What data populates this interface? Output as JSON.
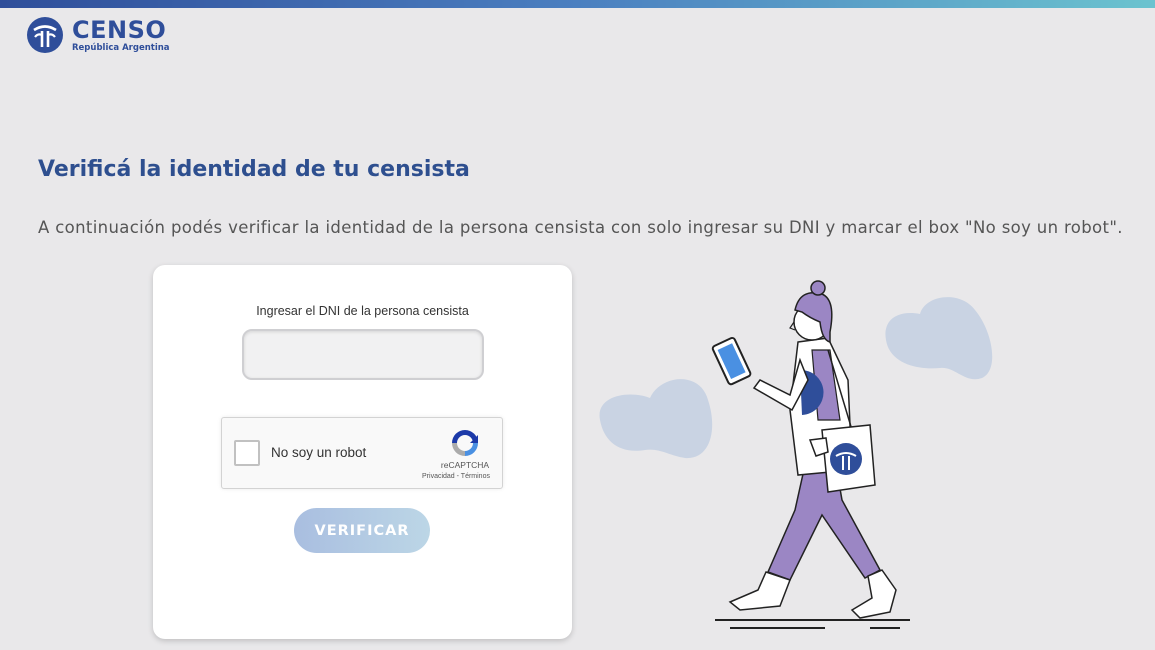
{
  "brand": {
    "name": "CENSO",
    "subtitle": "República Argentina",
    "logo_icon": "censo-emblem-icon",
    "color": "#2f4e9a"
  },
  "page": {
    "title": "Verificá la identidad de tu censista",
    "description": "A continuación podés verificar la identidad de la persona censista con solo ingresar su DNI y marcar el box \"No soy un robot\"."
  },
  "form": {
    "dni_label": "Ingresar el DNI de la persona censista",
    "dni_value": "",
    "dni_placeholder": "",
    "captcha": {
      "label": "No soy un robot",
      "brand": "reCAPTCHA",
      "links": "Privacidad - Términos",
      "checked": false
    },
    "submit_label": "VERIFICAR"
  },
  "colors": {
    "accent": "#2e4f8f",
    "illustration_purple": "#9b86c4",
    "blob": "#c9d3e3"
  }
}
